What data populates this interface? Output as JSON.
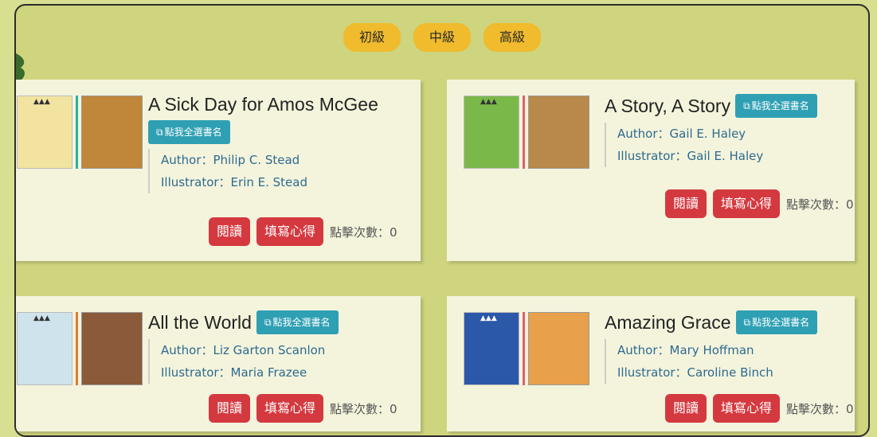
{
  "levels": [
    "初級",
    "中級",
    "高級"
  ],
  "copy_label": "點我全選書名",
  "read_label": "閱讀",
  "write_label": "填寫心得",
  "clicks_label": "點擊次數：",
  "books": [
    {
      "title": "A Sick Day for Amos McGee",
      "author": "Author：Philip C. Stead",
      "illustrator": "Illustrator：Erin E. Stead",
      "clicks": "0",
      "sep_color": "#2bb0a0",
      "cover_color": "#f2e3a0"
    },
    {
      "title": "A Story, A Story",
      "author": "Author：Gail E. Haley",
      "illustrator": "Illustrator：Gail E. Haley",
      "clicks": "0",
      "sep_color": "#e06070",
      "cover_color": "#7bb84a"
    },
    {
      "title": "All the World",
      "author": "Author：Liz Garton Scanlon",
      "illustrator": "Illustrator：Maria Frazee",
      "clicks": "0",
      "sep_color": "#e07a3a",
      "cover_color": "#cfe3ec"
    },
    {
      "title": "Amazing Grace",
      "author": "Author：Mary Hoffman",
      "illustrator": "Illustrator：Caroline Binch",
      "clicks": "0",
      "sep_color": "#e06070",
      "cover_color": "#2b58a8"
    }
  ],
  "icons": {
    "copy": "copy-icon",
    "tree": "tree-icon",
    "logo": "logo-icon"
  }
}
